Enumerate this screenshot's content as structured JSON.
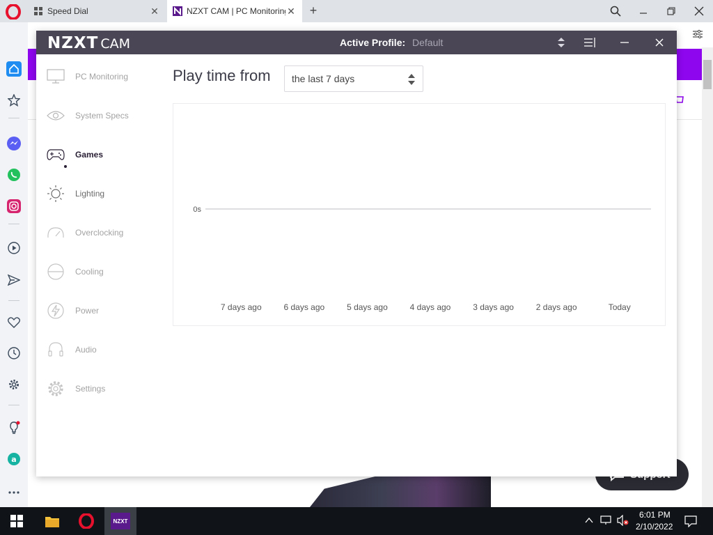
{
  "browser": {
    "tabs": [
      {
        "label": "Speed Dial",
        "active": false
      },
      {
        "label": "NZXT CAM | PC Monitoring",
        "active": true
      }
    ]
  },
  "background_page": {
    "support_label": "Support",
    "accent_color": "#8e06ee"
  },
  "app": {
    "logo_bold": "NZXT",
    "logo_light": "CAM",
    "profile_label": "Active Profile:",
    "profile_value": "Default",
    "nav": [
      {
        "label": "PC Monitoring",
        "icon": "monitor-icon",
        "state": "dim"
      },
      {
        "label": "System Specs",
        "icon": "eye-icon",
        "state": "dim"
      },
      {
        "label": "Games",
        "icon": "gamepad-icon",
        "state": "active"
      },
      {
        "label": "Lighting",
        "icon": "sun-icon",
        "state": "semi"
      },
      {
        "label": "Overclocking",
        "icon": "gauge-icon",
        "state": "dim"
      },
      {
        "label": "Cooling",
        "icon": "cooler-icon",
        "state": "dim"
      },
      {
        "label": "Power",
        "icon": "lightning-icon",
        "state": "dim"
      },
      {
        "label": "Audio",
        "icon": "headphones-icon",
        "state": "dim"
      },
      {
        "label": "Settings",
        "icon": "gear-icon",
        "state": "dim"
      }
    ],
    "heading": "Play time from",
    "range": {
      "value": "the last 7 days"
    }
  },
  "chart_data": {
    "type": "line",
    "categories": [
      "7 days ago",
      "6 days ago",
      "5 days ago",
      "4 days ago",
      "3 days ago",
      "2 days ago",
      "Today"
    ],
    "series": [
      {
        "values": [
          0,
          0,
          0,
          0,
          0,
          0,
          0
        ]
      }
    ],
    "yticks": [
      "0s"
    ],
    "ylim": [
      0,
      0
    ],
    "grid": false
  },
  "taskbar": {
    "time": "6:01 PM",
    "date": "2/10/2022",
    "app_label": "NZXT"
  }
}
